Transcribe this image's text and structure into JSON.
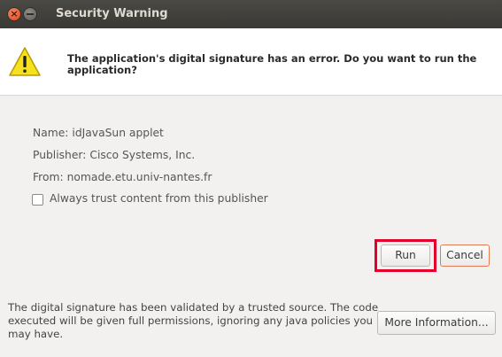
{
  "window": {
    "title": "Security Warning"
  },
  "header": {
    "message": "The application's digital signature has an error.  Do you want to run the application?",
    "icon": "warning-icon"
  },
  "details": {
    "name_label": "Name:",
    "name_value": "idJavaSun applet",
    "publisher_label": "Publisher:",
    "publisher_value": "Cisco Systems, Inc.",
    "from_label": "From:",
    "from_value": "nomade.etu.univ-nantes.fr",
    "trust_checkbox_label": "Always trust content from this publisher",
    "trust_checked": false
  },
  "buttons": {
    "run": "Run",
    "cancel": "Cancel",
    "more_information": "More Information..."
  },
  "footer": {
    "message": "The digital signature has been validated by a trusted source.  The code executed will be given full permissions, ignoring any java policies you may have."
  },
  "colors": {
    "titlebar": "#3c3b37",
    "highlight": "#e4002b",
    "warning_yellow": "#f5e11e"
  }
}
